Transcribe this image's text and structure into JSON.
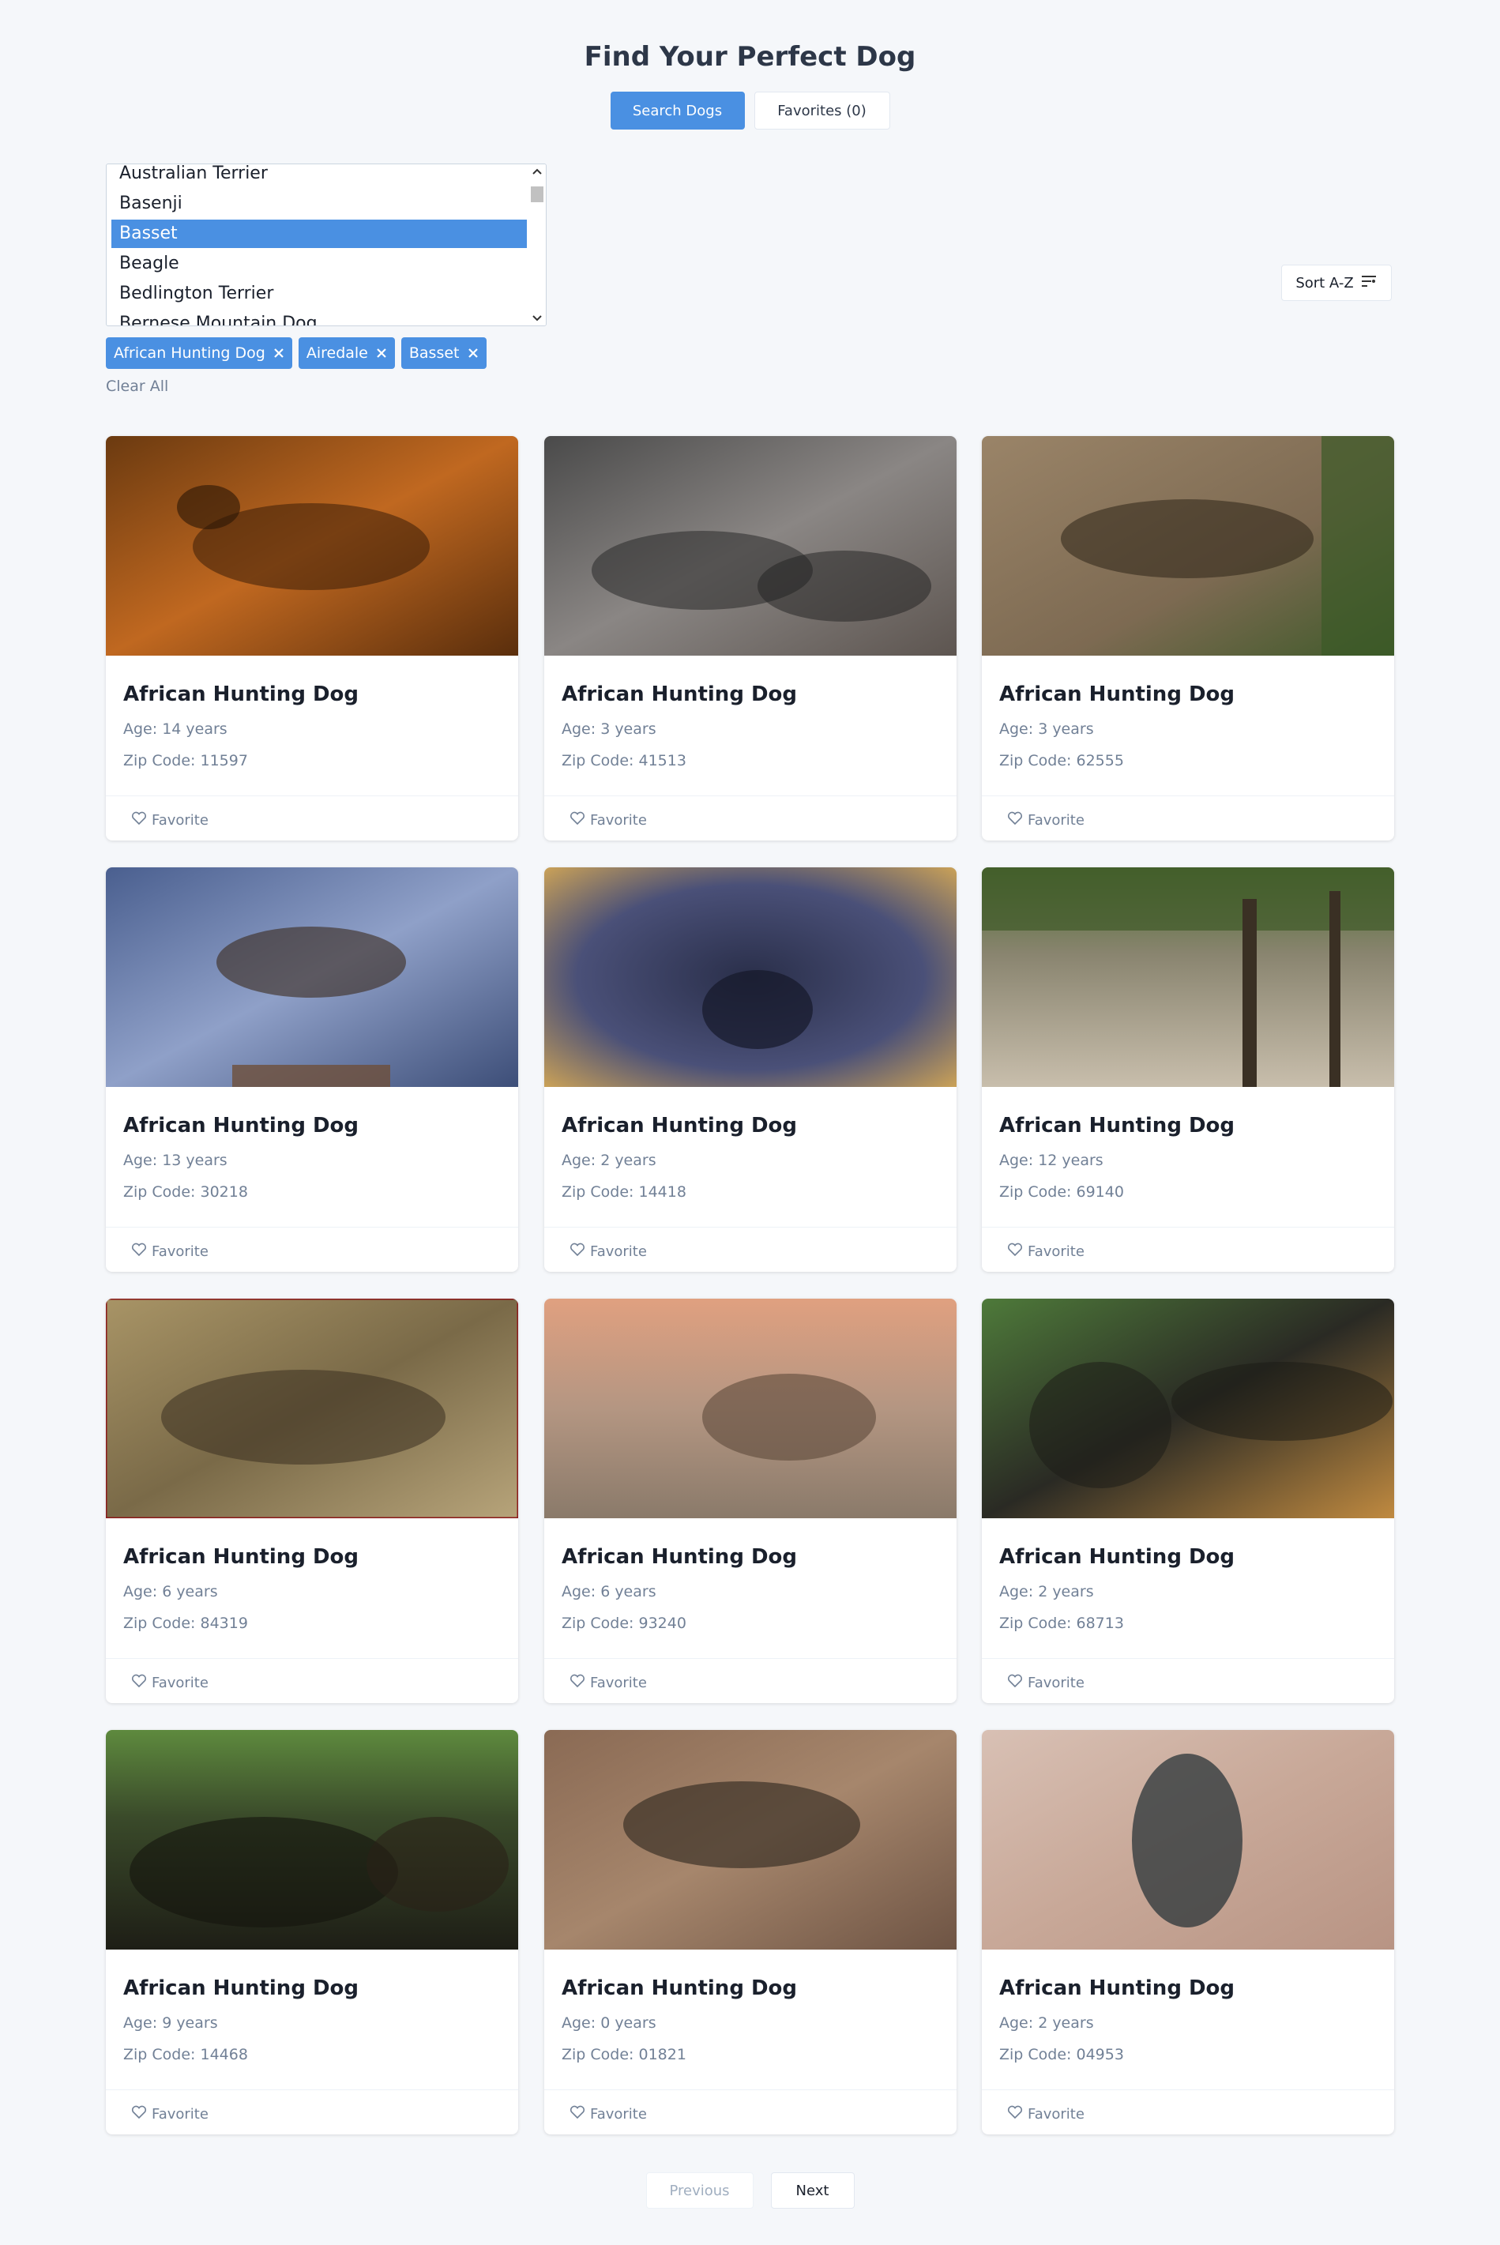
{
  "header": {
    "title": "Find Your Perfect Dog"
  },
  "tabs": [
    {
      "label": "Search Dogs",
      "active": true
    },
    {
      "label": "Favorites (0)",
      "active": false
    }
  ],
  "breed_list": {
    "options": [
      "Australian Terrier",
      "Basenji",
      "Basset",
      "Beagle",
      "Bedlington Terrier",
      "Bernese Mountain Dog"
    ],
    "selected": "Basset"
  },
  "sort": {
    "label": "Sort A-Z",
    "icon": "sort-lines-icon"
  },
  "filters": {
    "chips": [
      {
        "label": "African Hunting Dog"
      },
      {
        "label": "Airedale"
      },
      {
        "label": "Basset"
      }
    ],
    "clear_label": "Clear All"
  },
  "dogs": [
    {
      "name": "African Hunting Dog",
      "age": "Age: 14 years",
      "zip": "Zip Code: 11597",
      "favorite_label": "Favorite"
    },
    {
      "name": "African Hunting Dog",
      "age": "Age: 3 years",
      "zip": "Zip Code: 41513",
      "favorite_label": "Favorite"
    },
    {
      "name": "African Hunting Dog",
      "age": "Age: 3 years",
      "zip": "Zip Code: 62555",
      "favorite_label": "Favorite"
    },
    {
      "name": "African Hunting Dog",
      "age": "Age: 13 years",
      "zip": "Zip Code: 30218",
      "favorite_label": "Favorite"
    },
    {
      "name": "African Hunting Dog",
      "age": "Age: 2 years",
      "zip": "Zip Code: 14418",
      "favorite_label": "Favorite"
    },
    {
      "name": "African Hunting Dog",
      "age": "Age: 12 years",
      "zip": "Zip Code: 69140",
      "favorite_label": "Favorite"
    },
    {
      "name": "African Hunting Dog",
      "age": "Age: 6 years",
      "zip": "Zip Code: 84319",
      "favorite_label": "Favorite"
    },
    {
      "name": "African Hunting Dog",
      "age": "Age: 6 years",
      "zip": "Zip Code: 93240",
      "favorite_label": "Favorite"
    },
    {
      "name": "African Hunting Dog",
      "age": "Age: 2 years",
      "zip": "Zip Code: 68713",
      "favorite_label": "Favorite"
    },
    {
      "name": "African Hunting Dog",
      "age": "Age: 9 years",
      "zip": "Zip Code: 14468",
      "favorite_label": "Favorite"
    },
    {
      "name": "African Hunting Dog",
      "age": "Age: 0 years",
      "zip": "Zip Code: 01821",
      "favorite_label": "Favorite"
    },
    {
      "name": "African Hunting Dog",
      "age": "Age: 2 years",
      "zip": "Zip Code: 04953",
      "favorite_label": "Favorite"
    }
  ],
  "pagination": {
    "previous_label": "Previous",
    "next_label": "Next"
  },
  "colors": {
    "accent": "#4a90e2",
    "background": "#f5f7fa",
    "text": "#2d3748",
    "muted": "#718096"
  }
}
